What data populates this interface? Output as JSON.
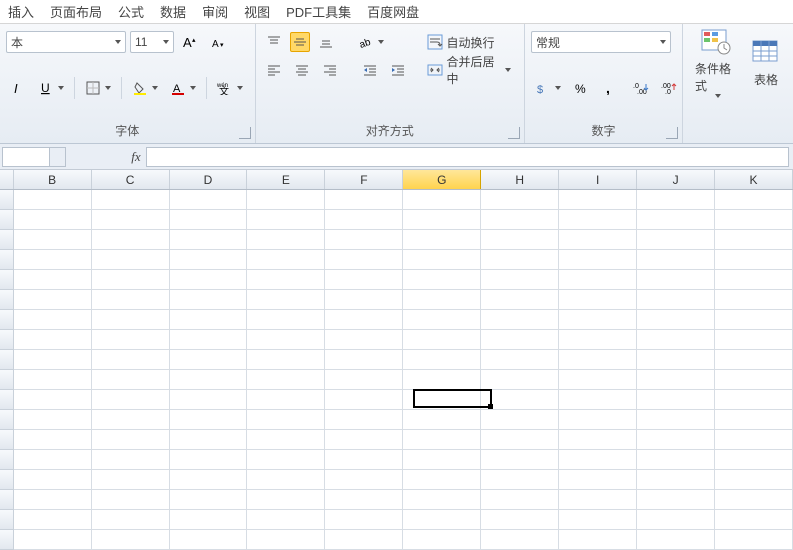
{
  "tabs": {
    "insert": "插入",
    "layout": "页面布局",
    "formulas": "公式",
    "data": "数据",
    "review": "审阅",
    "view": "视图",
    "pdf": "PDF工具集",
    "netdisk": "百度网盘"
  },
  "font": {
    "name": "本",
    "size": "11",
    "group_label": "字体"
  },
  "alignment": {
    "wrap": "自动换行",
    "merge": "合并后居中",
    "group_label": "对齐方式"
  },
  "number": {
    "format": "常规",
    "group_label": "数字"
  },
  "styles": {
    "cond_format": "条件格式",
    "table_styles": "表格"
  },
  "namebox": {
    "value": ""
  },
  "formula": {
    "fx": "fx",
    "value": ""
  },
  "columns": [
    "B",
    "C",
    "D",
    "E",
    "F",
    "G",
    "H",
    "I",
    "J",
    "K"
  ],
  "active_column": "G",
  "selection": {
    "col_index": 5,
    "row_index": 10
  }
}
